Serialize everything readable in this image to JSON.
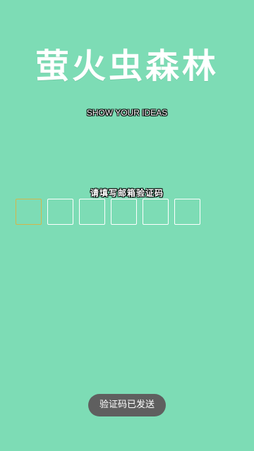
{
  "header": {
    "app_title": "萤火虫森林",
    "slogan": "SHOW YOUR IDEAS"
  },
  "verification": {
    "prompt": "请填写邮箱验证码",
    "code_digits": [
      "",
      "",
      "",
      "",
      "",
      ""
    ],
    "active_index": 0
  },
  "toast": {
    "message": "验证码已发送"
  },
  "colors": {
    "background": "#7ddcb5",
    "box_border": "#ffffff",
    "active_box_border": "#d4b64a",
    "toast_background": "#5f5f5f"
  }
}
